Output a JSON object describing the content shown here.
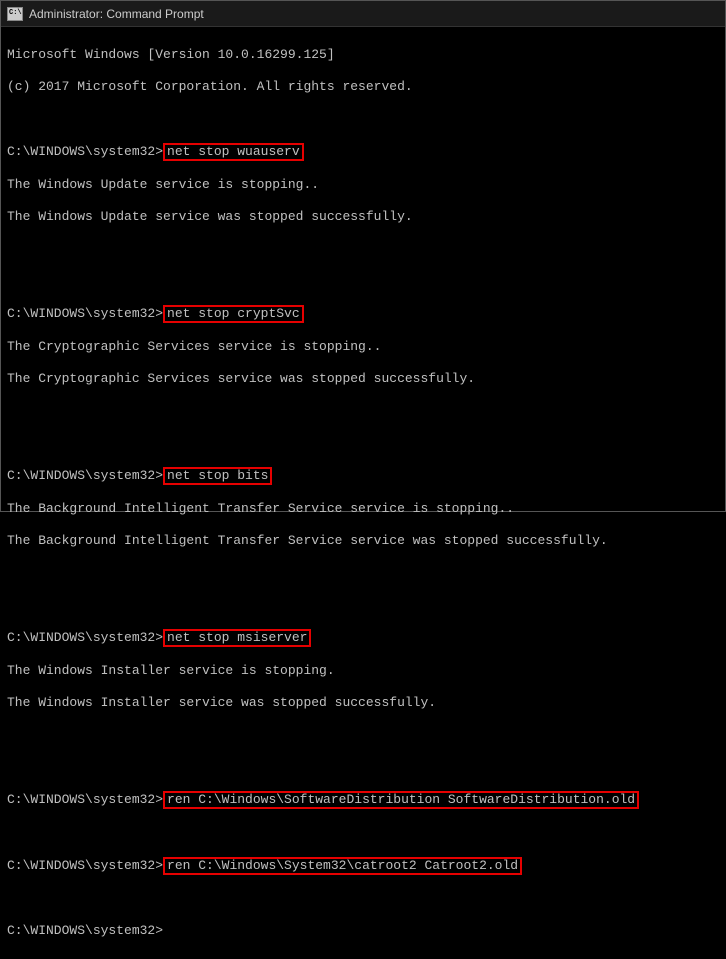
{
  "titlebar": {
    "title": "Administrator: Command Prompt"
  },
  "terminal": {
    "header1": "Microsoft Windows [Version 10.0.16299.125]",
    "header2": "(c) 2017 Microsoft Corporation. All rights reserved.",
    "prompt": "C:\\WINDOWS\\system32>",
    "cmd1": "net stop wuauserv",
    "out1a": "The Windows Update service is stopping..",
    "out1b": "The Windows Update service was stopped successfully.",
    "cmd2": "net stop cryptSvc",
    "out2a": "The Cryptographic Services service is stopping..",
    "out2b": "The Cryptographic Services service was stopped successfully.",
    "cmd3": "net stop bits",
    "out3a": "The Background Intelligent Transfer Service service is stopping..",
    "out3b": "The Background Intelligent Transfer Service service was stopped successfully.",
    "cmd4": "net stop msiserver",
    "out4a": "The Windows Installer service is stopping.",
    "out4b": "The Windows Installer service was stopped successfully.",
    "cmd5": "ren C:\\Windows\\SoftwareDistribution SoftwareDistribution.old",
    "cmd6": "ren C:\\Windows\\System32\\catroot2 Catroot2.old"
  }
}
